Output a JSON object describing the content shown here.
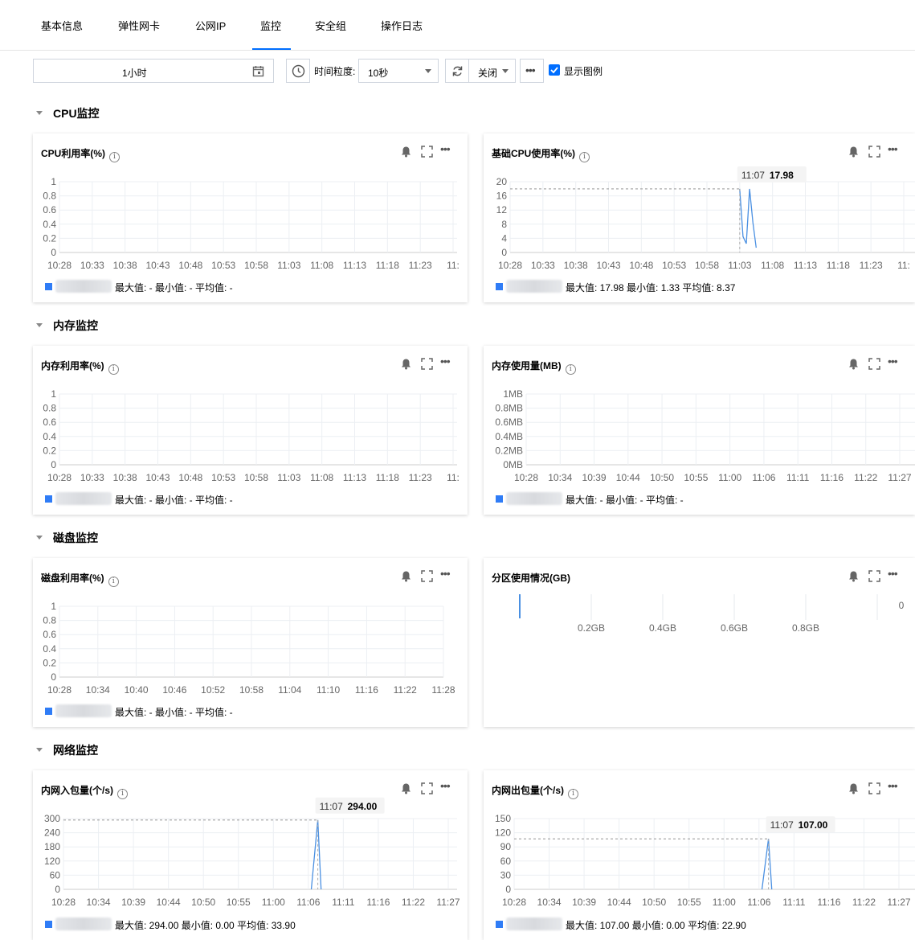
{
  "tabs": [
    {
      "label": "基本信息",
      "active": false
    },
    {
      "label": "弹性网卡",
      "active": false
    },
    {
      "label": "公网IP",
      "active": false
    },
    {
      "label": "监控",
      "active": true
    },
    {
      "label": "安全组",
      "active": false
    },
    {
      "label": "操作日志",
      "active": false
    }
  ],
  "toolbar": {
    "time_range": "1小时",
    "granularity_label": "时间粒度:",
    "granularity_value": "10秒",
    "refresh_value": "关闭",
    "show_legend_label": "显示图例",
    "show_legend_checked": true,
    "calendar_icon": "calendar-icon",
    "clock_icon": "clock-icon",
    "refresh_icon": "refresh-icon"
  },
  "sections": {
    "cpu": "CPU监控",
    "memory": "内存监控",
    "disk": "磁盘监控",
    "network": "网络监控"
  },
  "card_tool_icons": [
    "bell-icon",
    "fullscreen-icon",
    "more-icon"
  ],
  "colors": {
    "accent": "#006eff",
    "series": "#2f7cf6"
  },
  "chart_data": [
    {
      "id": "cpu_util",
      "type": "line",
      "title": "CPU利用率(%)",
      "x": [
        "10:28",
        "10:33",
        "10:38",
        "10:43",
        "10:48",
        "10:53",
        "10:58",
        "11:03",
        "11:08",
        "11:13",
        "11:18",
        "11:23",
        "11:"
      ],
      "y_ticks": [
        "1",
        "0.8",
        "0.6",
        "0.4",
        "0.2",
        "0"
      ],
      "ylim": [
        0,
        1
      ],
      "series": [],
      "legend_stats": "最大值: - 最小值: - 平均值: -"
    },
    {
      "id": "base_cpu",
      "type": "line",
      "title": "基础CPU使用率(%)",
      "x": [
        "10:28",
        "10:33",
        "10:38",
        "10:43",
        "10:48",
        "10:53",
        "10:58",
        "11:03",
        "11:08",
        "11:13",
        "11:18",
        "11:23",
        "11:"
      ],
      "y_ticks": [
        "20",
        "16",
        "12",
        "8",
        "4",
        "0"
      ],
      "ylim": [
        0,
        20
      ],
      "series": [
        {
          "values": [
            [
              11.03,
              17.98
            ],
            [
              11.035,
              4.5
            ],
            [
              11.04,
              2.5
            ],
            [
              11.045,
              17.98
            ],
            [
              11.05,
              8.5
            ],
            [
              11.055,
              1.33
            ]
          ]
        }
      ],
      "tooltip": {
        "time": "11:07",
        "value": "17.98"
      },
      "legend_stats": "最大值: 17.98 最小值: 1.33 平均值: 8.37"
    },
    {
      "id": "mem_util",
      "type": "line",
      "title": "内存利用率(%)",
      "x": [
        "10:28",
        "10:33",
        "10:38",
        "10:43",
        "10:48",
        "10:53",
        "10:58",
        "11:03",
        "11:08",
        "11:13",
        "11:18",
        "11:23",
        "11:"
      ],
      "y_ticks": [
        "1",
        "0.8",
        "0.6",
        "0.4",
        "0.2",
        "0"
      ],
      "ylim": [
        0,
        1
      ],
      "series": [],
      "legend_stats": "最大值: - 最小值: - 平均值: -"
    },
    {
      "id": "mem_used",
      "type": "line",
      "title": "内存使用量(MB)",
      "x": [
        "10:28",
        "10:34",
        "10:39",
        "10:44",
        "10:50",
        "10:55",
        "11:00",
        "11:06",
        "11:11",
        "11:16",
        "11:22",
        "11:27"
      ],
      "y_ticks": [
        "1MB",
        "0.8MB",
        "0.6MB",
        "0.4MB",
        "0.2MB",
        "0MB"
      ],
      "ylim": [
        0,
        1
      ],
      "series": [],
      "legend_stats": "最大值: - 最小值: - 平均值: -"
    },
    {
      "id": "disk_util",
      "type": "line",
      "title": "磁盘利用率(%)",
      "x": [
        "10:28",
        "10:34",
        "10:40",
        "10:46",
        "10:52",
        "10:58",
        "11:04",
        "11:10",
        "11:16",
        "11:22",
        "11:28"
      ],
      "y_ticks": [
        "1",
        "0.8",
        "0.6",
        "0.4",
        "0.2",
        "0"
      ],
      "ylim": [
        0,
        1
      ],
      "series": [],
      "legend_stats": "最大值: - 最小值: - 平均值: -"
    },
    {
      "id": "partition",
      "type": "bar",
      "title": "分区使用情况(GB)",
      "x_ticks": [
        "0.2GB",
        "0.4GB",
        "0.6GB",
        "0.8GB"
      ],
      "value_label": "0"
    },
    {
      "id": "net_in_pkg",
      "type": "line",
      "title": "内网入包量(个/s)",
      "x": [
        "10:28",
        "10:34",
        "10:39",
        "10:44",
        "10:50",
        "10:55",
        "11:00",
        "11:06",
        "11:11",
        "11:16",
        "11:22",
        "11:27"
      ],
      "y_ticks": [
        "300",
        "240",
        "180",
        "120",
        "60",
        "0"
      ],
      "ylim": [
        0,
        300
      ],
      "series": [
        {
          "values": [
            [
              11.06,
              0
            ],
            [
              11.07,
              294.0
            ],
            [
              11.075,
              0
            ]
          ]
        }
      ],
      "tooltip": {
        "time": "11:07",
        "value": "294.00"
      },
      "legend_stats": "最大值: 294.00 最小值: 0.00 平均值: 33.90"
    },
    {
      "id": "net_out_pkg",
      "type": "line",
      "title": "内网出包量(个/s)",
      "x": [
        "10:28",
        "10:34",
        "10:39",
        "10:44",
        "10:50",
        "10:55",
        "11:00",
        "11:06",
        "11:11",
        "11:16",
        "11:22",
        "11:27"
      ],
      "y_ticks": [
        "150",
        "120",
        "90",
        "60",
        "30",
        "0"
      ],
      "ylim": [
        0,
        150
      ],
      "series": [
        {
          "values": [
            [
              11.06,
              0
            ],
            [
              11.07,
              107.0
            ],
            [
              11.075,
              0
            ]
          ]
        }
      ],
      "tooltip": {
        "time": "11:07",
        "value": "107.00"
      },
      "legend_stats": "最大值: 107.00 最小值: 0.00 平均值: 22.90"
    }
  ]
}
